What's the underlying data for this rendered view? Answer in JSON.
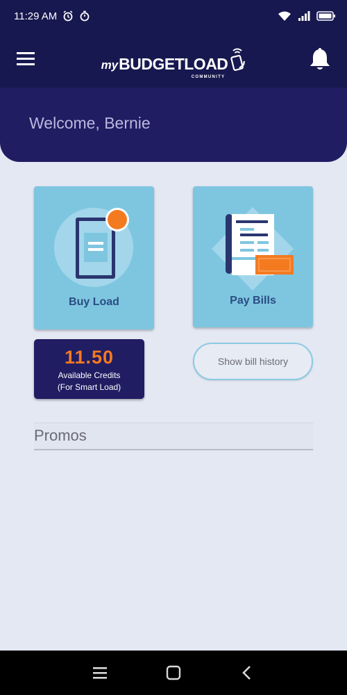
{
  "status_bar": {
    "time": "11:29 AM",
    "icons": [
      "alarm-icon",
      "timer-icon",
      "wifi-icon",
      "signal-icon",
      "battery-icon"
    ]
  },
  "app_bar": {
    "logo_my": "my",
    "logo_main": "BUDGETLOAD",
    "logo_sub": "COMMUNITY",
    "menu_icon": "hamburger-menu-icon",
    "notification_icon": "bell-icon"
  },
  "welcome": {
    "text": "Welcome, Bernie"
  },
  "cards": {
    "buy_load": {
      "label": "Buy Load",
      "icon": "phone-icon"
    },
    "pay_bills": {
      "label": "Pay Bills",
      "icon": "bill-receipt-icon"
    }
  },
  "credits": {
    "amount": "11.50",
    "label": "Available Credits",
    "sub_label": "(For Smart Load)"
  },
  "history_button": {
    "label": "Show bill history"
  },
  "promos": {
    "title": "Promos"
  },
  "nav_bar": {
    "icons": [
      "recent-apps-icon",
      "home-icon",
      "back-icon"
    ]
  },
  "colors": {
    "primary_dark": "#181850",
    "header": "#201d63",
    "card_bg": "#7ec6e0",
    "card_label": "#2a4c82",
    "accent_orange": "#f47a20",
    "background": "#e4e8f3"
  }
}
